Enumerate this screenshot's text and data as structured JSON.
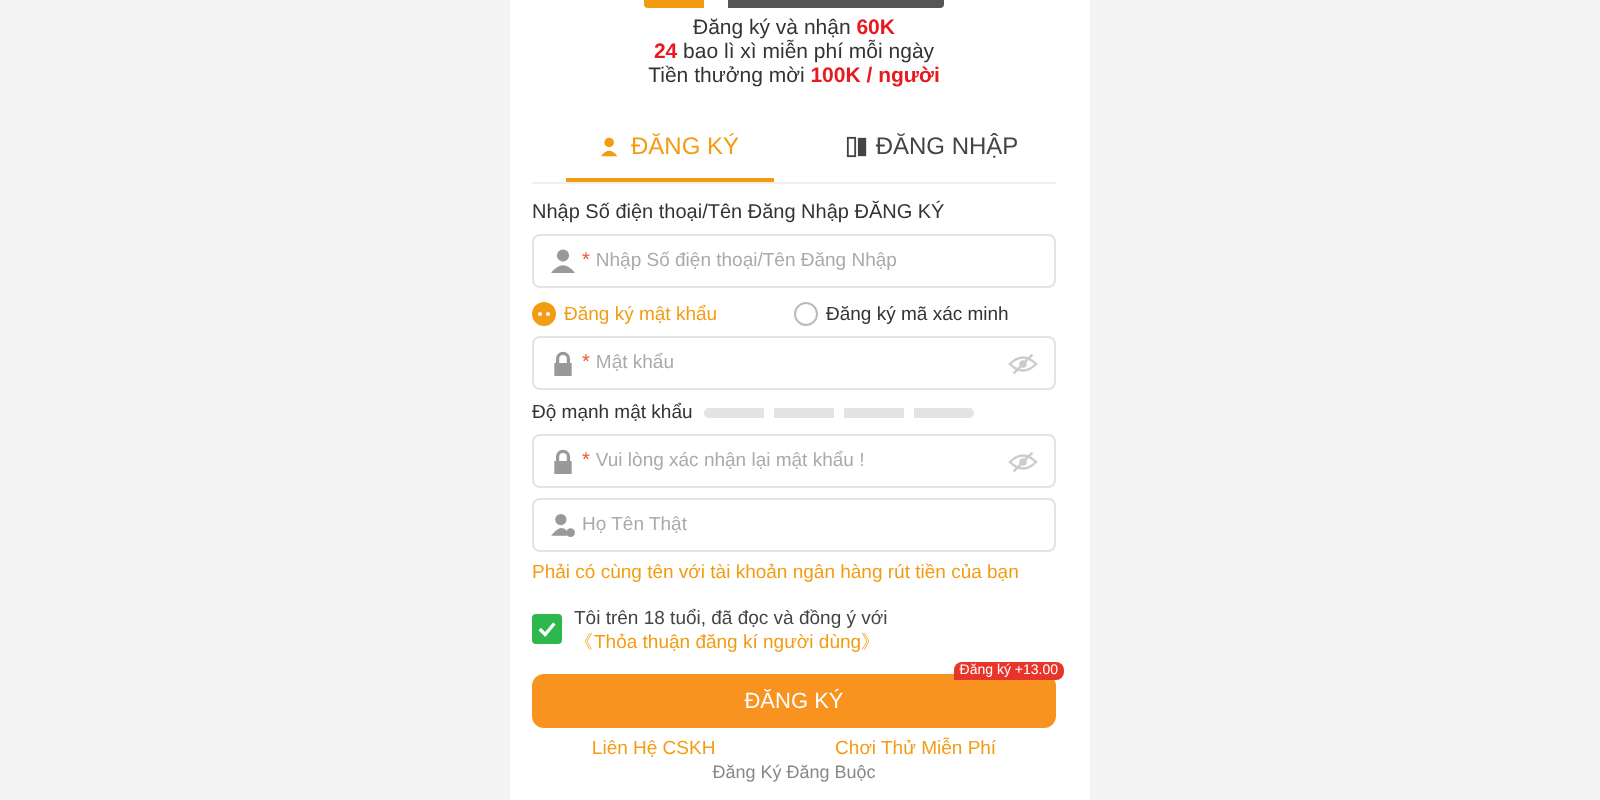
{
  "promo": [
    "Đăng ký và nhận **60K**",
    "**24** bao lì xì miễn phí mỗi ngày",
    "Tiền thưởng mời **100K / người**"
  ],
  "tabs": [
    {
      "label": "ĐĂNG KÝ",
      "kind": "register",
      "selected": true
    },
    {
      "label": "ĐĂNG NHẬP",
      "kind": "login",
      "selected": false
    }
  ],
  "form_label": "Nhập Số điện thoại/Tên Đăng Nhập ĐĂNG KÝ",
  "fields": [
    {
      "kind": "user",
      "mark": "*",
      "placeholder": "Nhập Số điện thoại/Tên Đăng Nhập",
      "eye": false
    },
    {
      "kind": "lock",
      "mark": "*",
      "placeholder": "Mật khẩu",
      "eye": true
    },
    {
      "kind": "lock",
      "mark": "*",
      "placeholder": "Vui lòng xác nhận lại mật khẩu !",
      "eye": true
    },
    {
      "kind": "person",
      "placeholder": "Họ Tên Thật",
      "eye": false
    }
  ],
  "methods": [
    {
      "label": "Đăng ký mật khẩu",
      "selected": true
    },
    {
      "label": "Đăng ký mã xác minh",
      "selected": false
    }
  ],
  "strength": {
    "label": "Độ mạnh mật khẩu",
    "level": 0
  },
  "name_hint": "Phải có cùng tên với tài khoản ngân hàng rút tiền của bạn",
  "agreement": {
    "checked": true,
    "text": "Tôi trên 18 tuổi, đã đọc và đồng ý với",
    "link": "《Thỏa thuận đăng kí người dùng》"
  },
  "submit": {
    "label": "ĐĂNG KÝ",
    "badge": "Đăng ký +13.00"
  },
  "links": [
    "Liên Hệ CSKH",
    "Chơi Thử Miễn Phí"
  ],
  "footer": "Đăng Ký Đăng Buộc"
}
